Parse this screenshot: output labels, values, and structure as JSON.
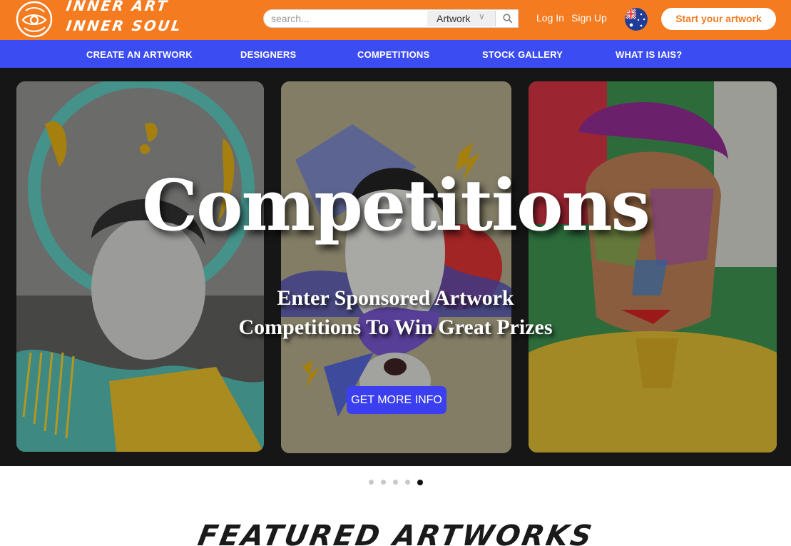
{
  "brand": {
    "line1": "Inner Art",
    "line2": "Inner Soul",
    "accent": "#f47b20"
  },
  "search": {
    "placeholder": "search...",
    "category": "Artwork",
    "search_icon": "search-icon"
  },
  "auth": {
    "login": "Log In",
    "signup": "Sign Up"
  },
  "locale": {
    "flag_icon": "australia-flag-icon"
  },
  "cta": {
    "start_label": "Start your artwork"
  },
  "nav": {
    "color": "#3b4cf2",
    "items": [
      {
        "label": "CREATE AN ARTWORK"
      },
      {
        "label": "DESIGNERS"
      },
      {
        "label": "COMPETITIONS"
      },
      {
        "label": "STOCK GALLERY"
      },
      {
        "label": "WHAT IS IAIS?"
      }
    ]
  },
  "hero": {
    "title": "Competitions",
    "subtitle_line1": "Enter Sponsored Artwork",
    "subtitle_line2": "Competitions To Win Great Prizes",
    "button": "GET MORE INFO",
    "button_color": "#3b3ff0"
  },
  "slider": {
    "slide_count": 5,
    "active_slide": 5
  },
  "featured": {
    "heading": "Featured Artworks"
  }
}
